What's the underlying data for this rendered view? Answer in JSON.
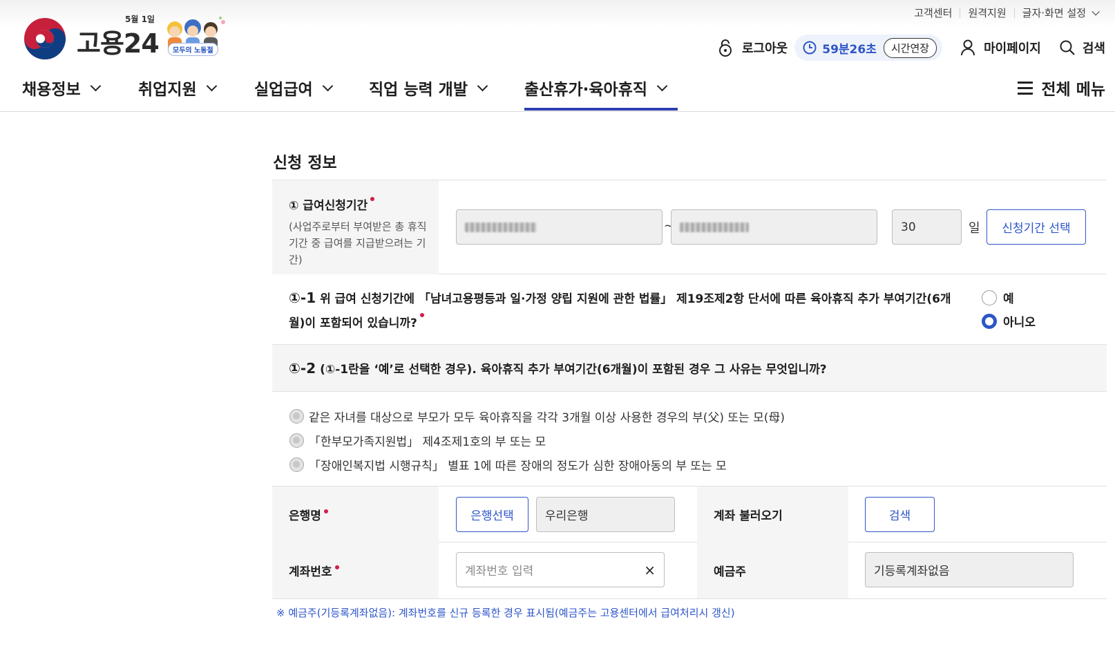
{
  "utility": {
    "customer_center": "고객센터",
    "remote_support": "원격지원",
    "display_settings": "글자·화면 설정"
  },
  "logo": {
    "brand": "고용24",
    "event_date": "5월 1일",
    "event_tag": "모두의 노동절"
  },
  "header": {
    "logout": "로그아웃",
    "session_time": "59분26초",
    "extend": "시간연장",
    "mypage": "마이페이지",
    "search": "검색"
  },
  "gnb": {
    "items": [
      "채용정보",
      "취업지원",
      "실업급여",
      "직업 능력 개발",
      "출산휴가·육아휴직"
    ],
    "active_index": 4,
    "all_menu": "전체 메뉴"
  },
  "form": {
    "section_title": "신청 정보",
    "period": {
      "label": "① 급여신청기간",
      "sub": "(사업주로부터 부여받은 총 휴직기간 중 급여를 지급받으려는 기간)",
      "tilde": "~",
      "days": "30",
      "days_unit": "일",
      "select_button": "신청기간 선택"
    },
    "q1": {
      "num": "①-1",
      "text": "위 급여 신청기간에 「남녀고용평등과 일·가정 양립 지원에 관한 법률」 제19조제2항 단서에 따른 육아휴직 추가 부여기간(6개월)이 포함되어 있습니까?",
      "yes": "예",
      "no": "아니오",
      "selected": "아니오"
    },
    "q2": {
      "num": "①-2",
      "text": "(①-1란을 ‘예’로 선택한 경우). 육아휴직 추가 부여기간(6개월)이 포함된 경우 그 사유는 무엇입니까?",
      "options": [
        "같은 자녀를 대상으로 부모가 모두 육아휴직을 각각 3개월 이상 사용한 경우의 부(父) 또는 모(母)",
        "「한부모가족지원법」 제4조제1호의 부 또는 모",
        "「장애인복지법 시행규칙」 별표 1에 따른 장애의 정도가 심한 장애아동의 부 또는 모"
      ]
    },
    "bank": {
      "label": "은행명",
      "select_button": "은행선택",
      "bank_value": "우리은행",
      "load_label": "계좌 불러오기",
      "search_button": "검색"
    },
    "account": {
      "label": "계좌번호",
      "placeholder": "계좌번호 입력",
      "clear": "×",
      "holder_label": "예금주",
      "holder_value": "기등록계좌없음"
    },
    "note": "※ 예금주(기등록계좌없음): 계좌번호를 신규 등록한 경우 표시됨(예금주는 고용센터에서 급여처리시 갱신)"
  },
  "colors": {
    "accent": "#2d55c8",
    "required": "#d21d4a",
    "active_bar": "#2d3fb0"
  }
}
